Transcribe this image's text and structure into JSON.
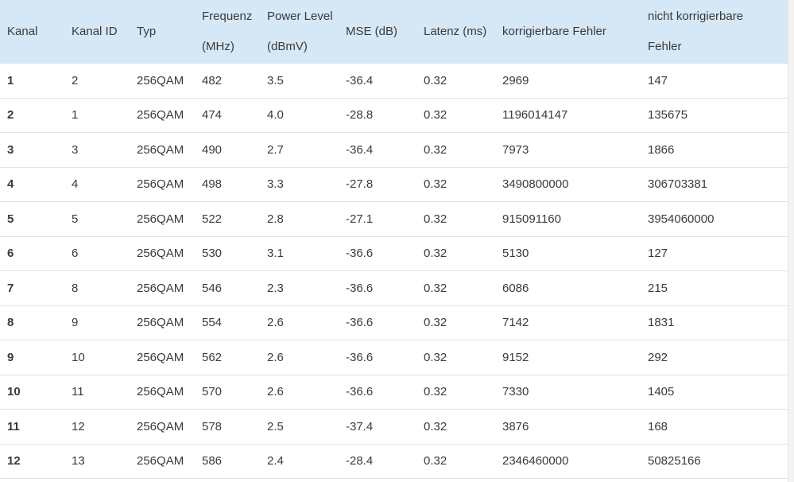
{
  "table": {
    "headers": [
      {
        "line1": "Kanal",
        "line2": ""
      },
      {
        "line1": "Kanal ID",
        "line2": ""
      },
      {
        "line1": "Typ",
        "line2": ""
      },
      {
        "line1": "Frequenz",
        "line2": "(MHz)"
      },
      {
        "line1": "Power Level",
        "line2": "(dBmV)"
      },
      {
        "line1": "MSE (dB)",
        "line2": ""
      },
      {
        "line1": "Latenz (ms)",
        "line2": ""
      },
      {
        "line1": "korrigierbare Fehler",
        "line2": ""
      },
      {
        "line1": "nicht korrigierbare",
        "line2": "Fehler"
      }
    ],
    "rows": [
      [
        "1",
        "2",
        "256QAM",
        "482",
        "3.5",
        "-36.4",
        "0.32",
        "2969",
        "147"
      ],
      [
        "2",
        "1",
        "256QAM",
        "474",
        "4.0",
        "-28.8",
        "0.32",
        "1196014147",
        "135675"
      ],
      [
        "3",
        "3",
        "256QAM",
        "490",
        "2.7",
        "-36.4",
        "0.32",
        "7973",
        "1866"
      ],
      [
        "4",
        "4",
        "256QAM",
        "498",
        "3.3",
        "-27.8",
        "0.32",
        "3490800000",
        "306703381"
      ],
      [
        "5",
        "5",
        "256QAM",
        "522",
        "2.8",
        "-27.1",
        "0.32",
        "915091160",
        "3954060000"
      ],
      [
        "6",
        "6",
        "256QAM",
        "530",
        "3.1",
        "-36.6",
        "0.32",
        "5130",
        "127"
      ],
      [
        "7",
        "8",
        "256QAM",
        "546",
        "2.3",
        "-36.6",
        "0.32",
        "6086",
        "215"
      ],
      [
        "8",
        "9",
        "256QAM",
        "554",
        "2.6",
        "-36.6",
        "0.32",
        "7142",
        "1831"
      ],
      [
        "9",
        "10",
        "256QAM",
        "562",
        "2.6",
        "-36.6",
        "0.32",
        "9152",
        "292"
      ],
      [
        "10",
        "11",
        "256QAM",
        "570",
        "2.6",
        "-36.6",
        "0.32",
        "7330",
        "1405"
      ],
      [
        "11",
        "12",
        "256QAM",
        "578",
        "2.5",
        "-37.4",
        "0.32",
        "3876",
        "168"
      ],
      [
        "12",
        "13",
        "256QAM",
        "586",
        "2.4",
        "-28.4",
        "0.32",
        "2346460000",
        "50825166"
      ]
    ]
  },
  "colors": {
    "header_bg": "#d6e7f5",
    "text": "#3a3a3a"
  }
}
